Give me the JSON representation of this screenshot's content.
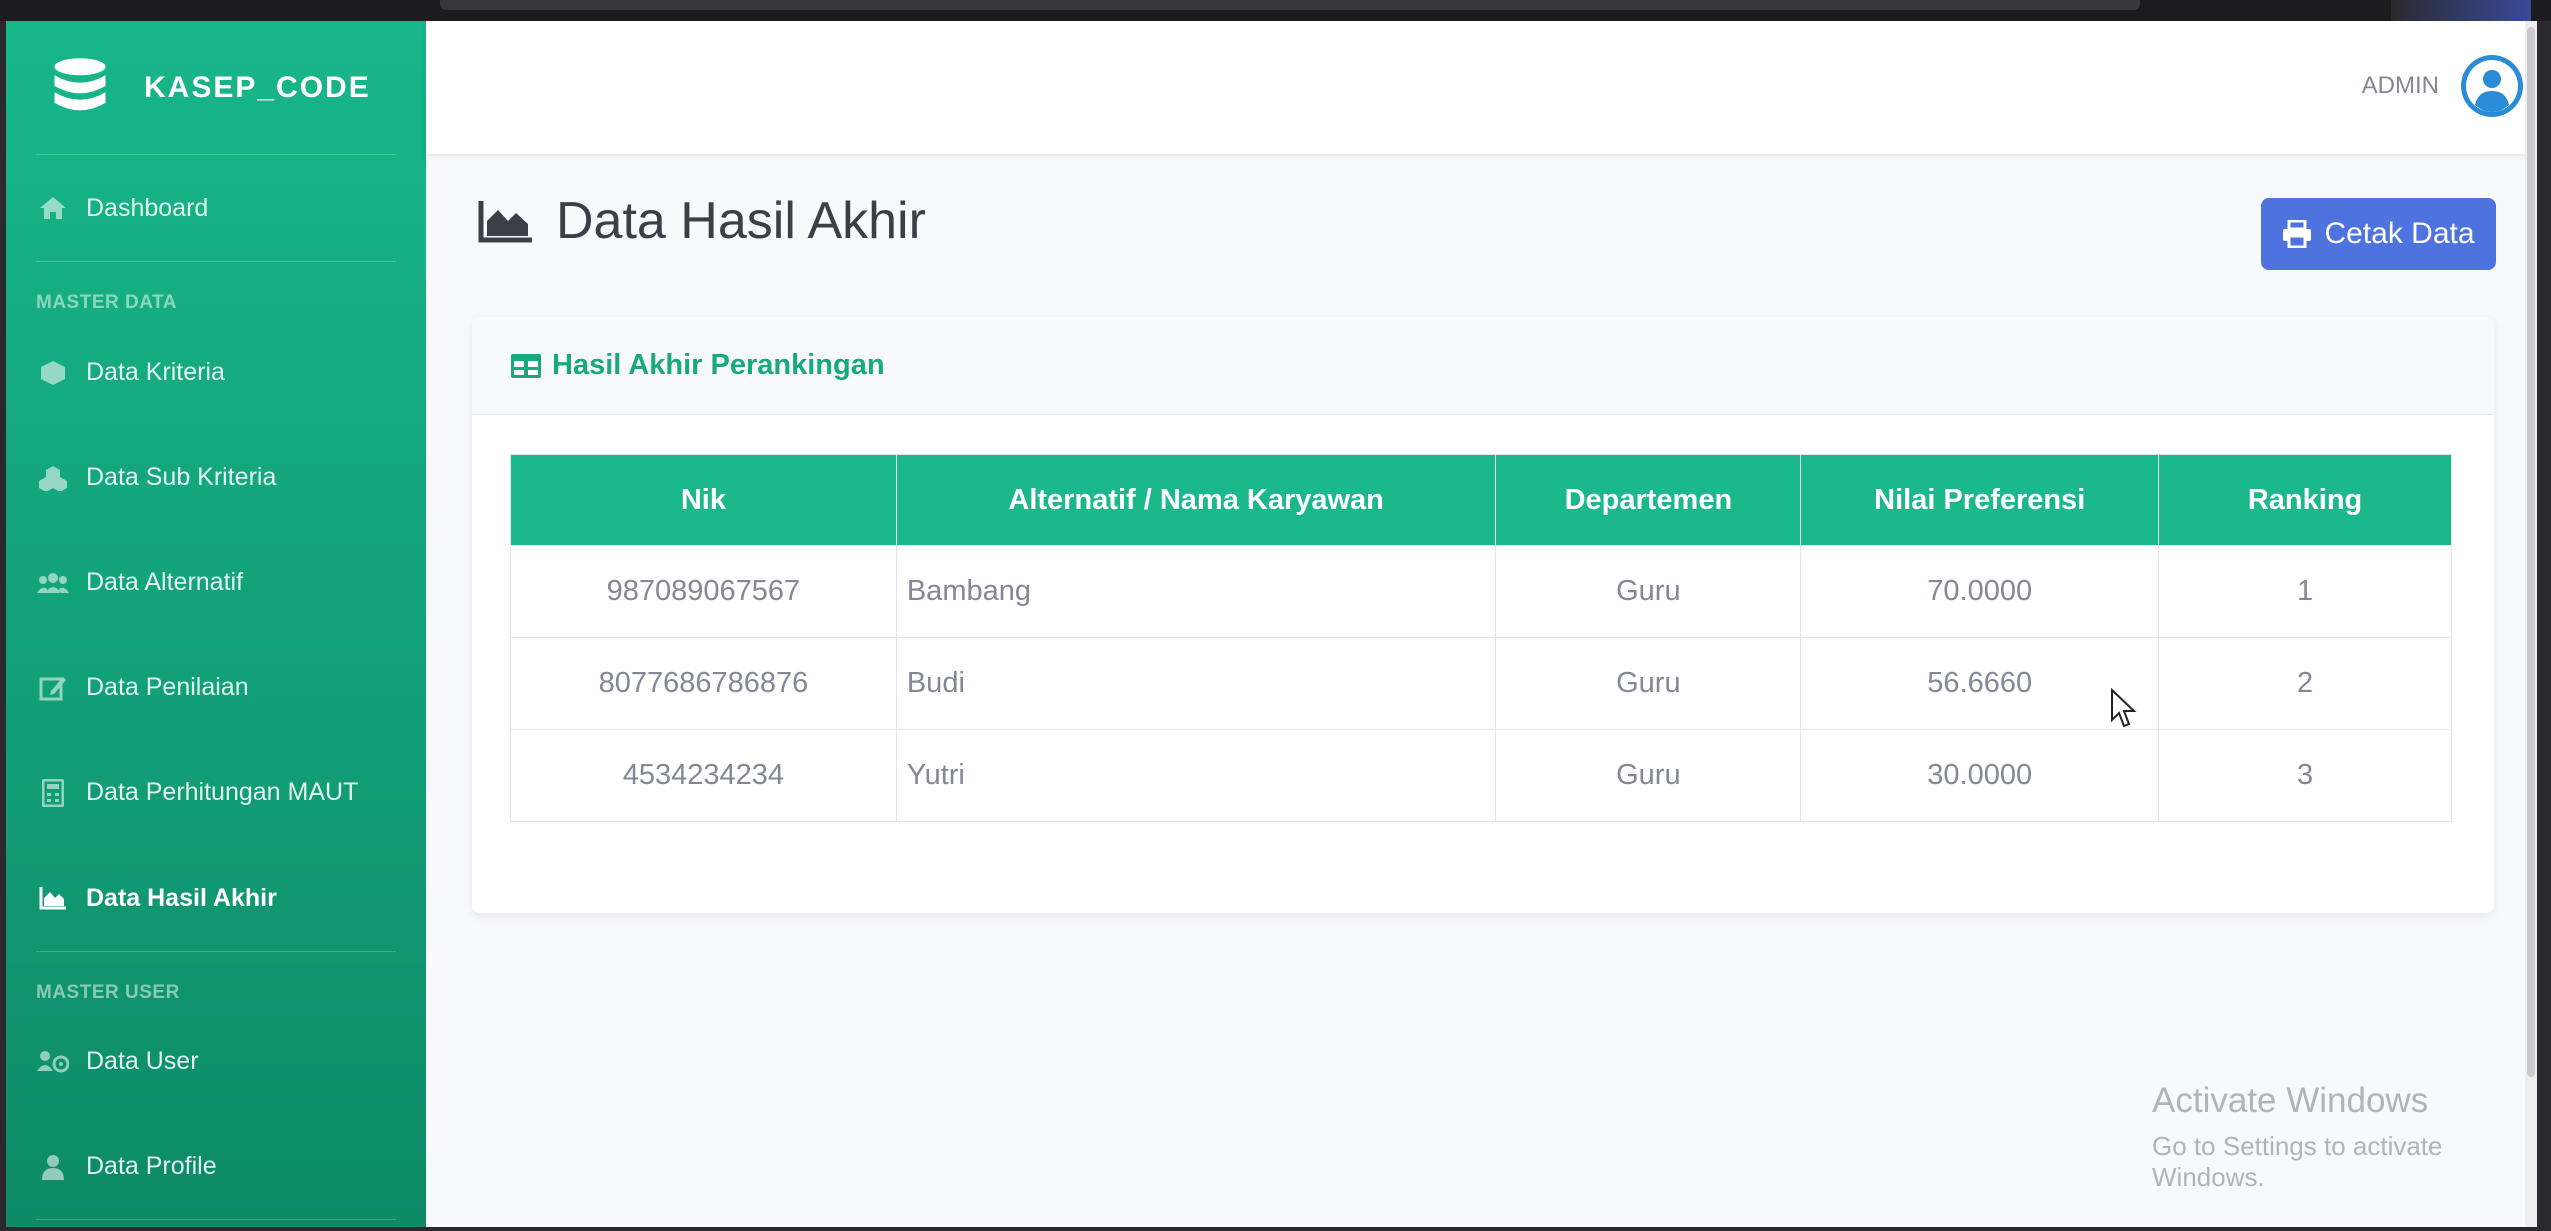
{
  "brand": {
    "name": "KASEP_CODE"
  },
  "sidebar": {
    "items": [
      {
        "label": "Dashboard",
        "icon": "home-icon"
      },
      {
        "section": "MASTER DATA"
      },
      {
        "label": "Data Kriteria",
        "icon": "cube-icon"
      },
      {
        "label": "Data Sub Kriteria",
        "icon": "cubes-icon"
      },
      {
        "label": "Data Alternatif",
        "icon": "users-icon"
      },
      {
        "label": "Data Penilaian",
        "icon": "edit-icon"
      },
      {
        "label": "Data Perhitungan MAUT",
        "icon": "calculator-icon"
      },
      {
        "label": "Data Hasil Akhir",
        "icon": "area-chart-icon",
        "active": true
      },
      {
        "section": "MASTER USER"
      },
      {
        "label": "Data User",
        "icon": "users-cog-icon"
      },
      {
        "label": "Data Profile",
        "icon": "user-icon"
      }
    ]
  },
  "topbar": {
    "username": "ADMIN"
  },
  "page": {
    "title": "Data Hasil Akhir",
    "print_button": "Cetak Data"
  },
  "card": {
    "title": "Hasil Akhir Perankingan",
    "table": {
      "headers": [
        "Nik",
        "Alternatif / Nama Karyawan",
        "Departemen",
        "Nilai Preferensi",
        "Ranking"
      ],
      "rows": [
        [
          "987089067567",
          "Bambang",
          "Guru",
          "70.0000",
          "1"
        ],
        [
          "8077686786876",
          "Budi",
          "Guru",
          "56.6660",
          "2"
        ],
        [
          "4534234234",
          "Yutri",
          "Guru",
          "30.0000",
          "3"
        ]
      ]
    }
  },
  "watermark": {
    "line1": "Activate Windows",
    "line2": "Go to Settings to activate Windows."
  },
  "colors": {
    "sidebar": "#18b68a",
    "accent": "#1bb88c",
    "primary_button": "#4e73df"
  }
}
